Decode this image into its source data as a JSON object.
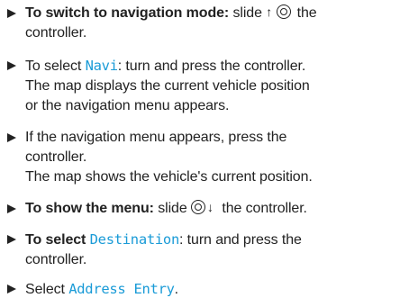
{
  "steps": [
    {
      "bold": "To switch to navigation mode:",
      "pre": " slide ",
      "post": " the",
      "cont": "controller."
    },
    {
      "pre": "To select ",
      "ui": "Navi",
      "post": ": turn and press the controller.",
      "l2": "The map displays the current vehicle position",
      "l3": "or the navigation menu appears."
    },
    {
      "l1": "If the navigation menu appears, press the",
      "l2": "controller.",
      "l3": "The map shows the vehicle's current position."
    },
    {
      "bold": "To show the menu:",
      "pre": " slide ",
      "post": " the controller."
    },
    {
      "bold": "To select ",
      "ui": "Destination",
      "post": ": turn and press the",
      "cont": "controller."
    },
    {
      "pre": "Select ",
      "ui": "Address Entry",
      "post": "."
    }
  ],
  "icons": {
    "up": "controller-slide-up-icon",
    "down": "controller-slide-down-icon",
    "bullet": "bullet-arrow-icon"
  }
}
